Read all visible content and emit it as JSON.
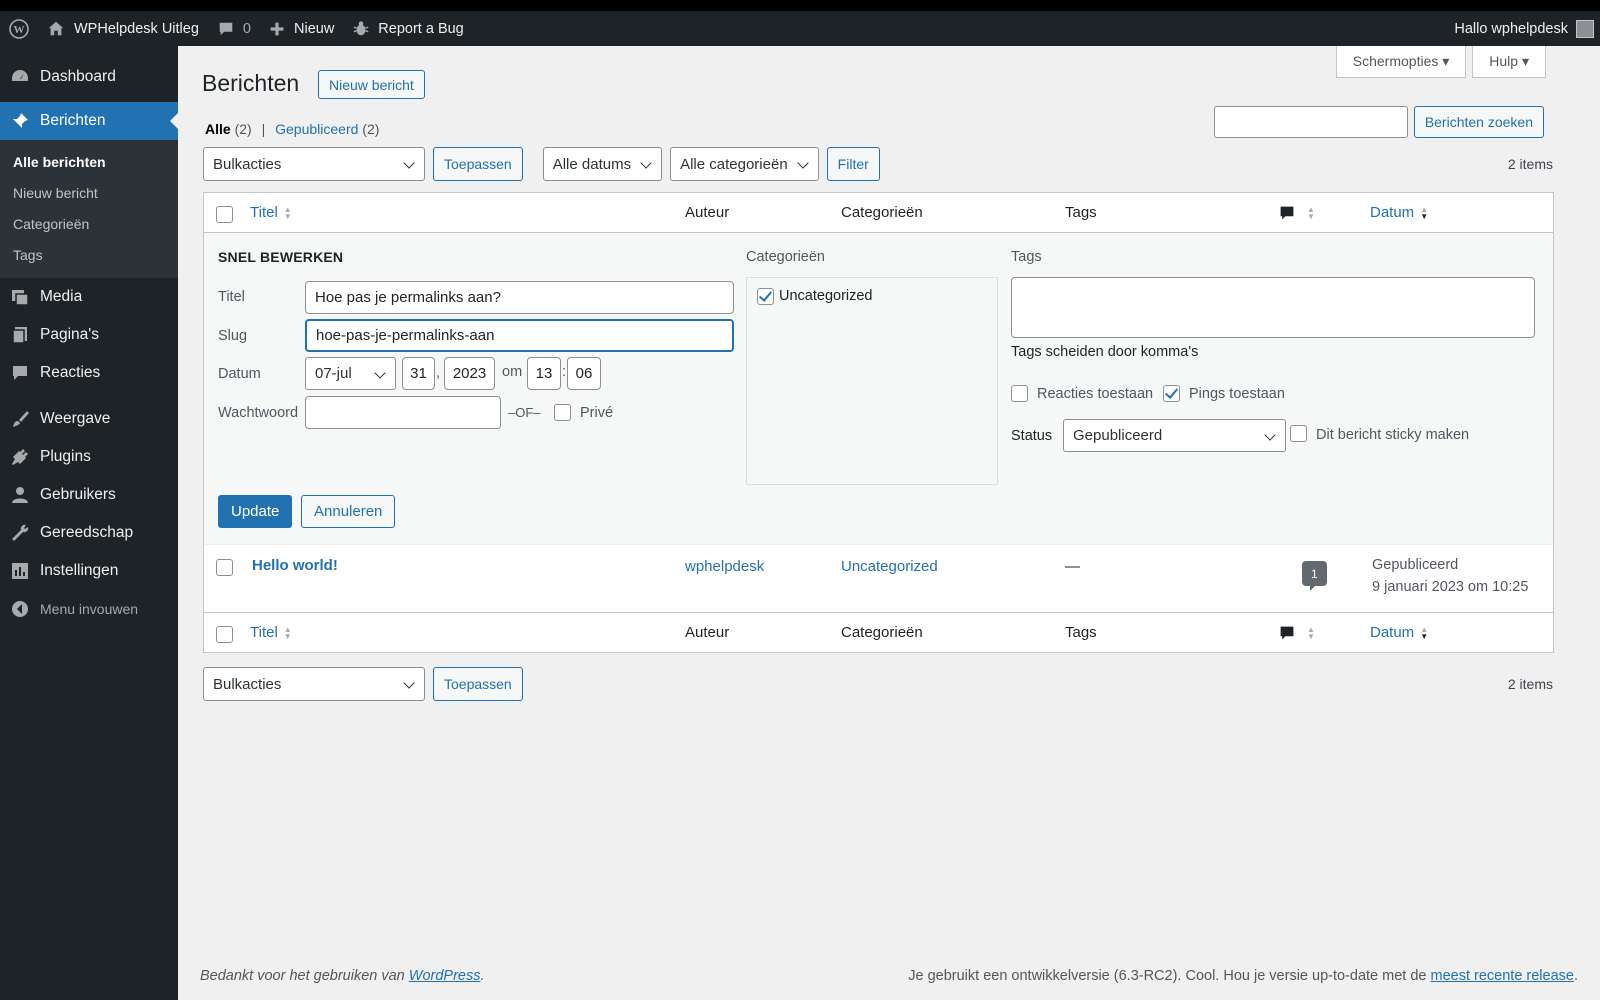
{
  "adminbar": {
    "site_name": "WPHelpdesk Uitleg",
    "comments_count": "0",
    "new_label": "Nieuw",
    "bug_label": "Report a Bug",
    "greeting": "Hallo wphelpdesk"
  },
  "sidebar": {
    "dashboard": "Dashboard",
    "posts": "Berichten",
    "submenu": [
      "Alle berichten",
      "Nieuw bericht",
      "Categorieën",
      "Tags"
    ],
    "media": "Media",
    "pages": "Pagina's",
    "comments": "Reacties",
    "appearance": "Weergave",
    "plugins": "Plugins",
    "users": "Gebruikers",
    "tools": "Gereedschap",
    "settings": "Instellingen",
    "collapse": "Menu invouwen"
  },
  "header": {
    "screen_options": "Schermopties",
    "help": "Hulp",
    "title": "Berichten",
    "new_post": "Nieuw bericht",
    "search_button": "Berichten zoeken",
    "search_value": ""
  },
  "filters": {
    "all_label": "Alle",
    "all_count": "(2)",
    "separator": "|",
    "published_label": "Gepubliceerd",
    "published_count": "(2)",
    "bulk_actions": "Bulkacties",
    "apply": "Toepassen",
    "all_dates": "Alle datums",
    "all_categories": "Alle categorieën",
    "filter": "Filter",
    "items_count": "2 items"
  },
  "columns": {
    "title": "Titel",
    "author": "Auteur",
    "categories": "Categorieën",
    "tags": "Tags",
    "date": "Datum"
  },
  "quick_edit": {
    "heading": "Snel bewerken",
    "title_label": "Titel",
    "title_value": "Hoe pas je permalinks aan?",
    "slug_label": "Slug",
    "slug_value": "hoe-pas-je-permalinks-aan",
    "date_label": "Datum",
    "month": "07-jul",
    "day": "31",
    "comma": ",",
    "year": "2023",
    "at": "om",
    "hour": "13",
    "colon": ":",
    "minute": "06",
    "password_label": "Wachtwoord",
    "password_value": "",
    "or": "–OF–",
    "private": "Privé",
    "categories_label": "Categorieën",
    "category_item": "Uncategorized",
    "tags_label": "Tags",
    "tags_value": "",
    "tags_help": "Tags scheiden door komma's",
    "allow_comments": "Reacties toestaan",
    "allow_pings": "Pings toestaan",
    "status_label": "Status",
    "status_value": "Gepubliceerd",
    "sticky": "Dit bericht sticky maken",
    "update": "Update",
    "cancel": "Annuleren"
  },
  "rows": [
    {
      "title": "Hello world!",
      "author": "wphelpdesk",
      "category": "Uncategorized",
      "tags": "—",
      "comments": "1",
      "status": "Gepubliceerd",
      "date": "9 januari 2023 om 10:25"
    }
  ],
  "footer": {
    "thanks_prefix": "Bedankt voor het gebruiken van",
    "wordpress_link": "WordPress",
    "thanks_suffix": ".",
    "version_text": "Je gebruikt een ontwikkelversie (6.3-RC2). Cool. Hou je versie up-to-date met de",
    "latest_link": "meest recente release",
    "version_suffix": "."
  }
}
